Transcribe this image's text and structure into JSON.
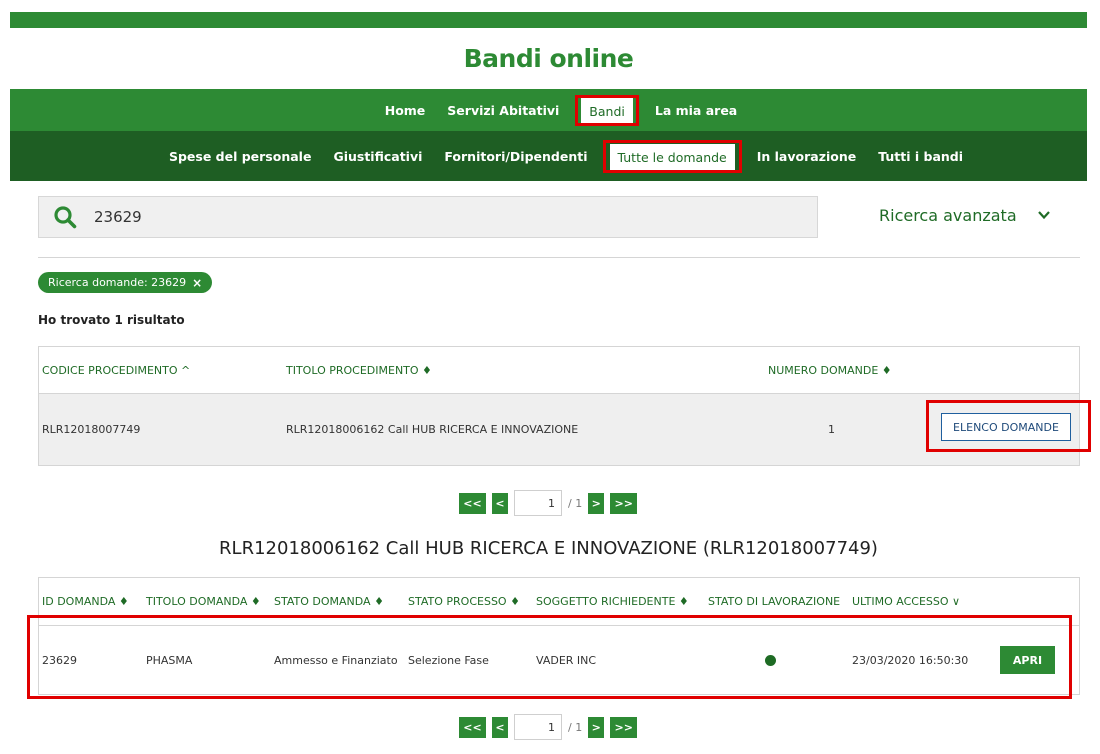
{
  "site": {
    "title": "Bandi online"
  },
  "nav_main": {
    "items": [
      {
        "label": "Home"
      },
      {
        "label": "Servizi Abitativi"
      },
      {
        "label": "Bandi"
      },
      {
        "label": "La mia area"
      }
    ],
    "active_index": 2
  },
  "nav_sub": {
    "items": [
      {
        "label": "Spese del personale"
      },
      {
        "label": "Giustificativi"
      },
      {
        "label": "Fornitori/Dipendenti"
      },
      {
        "label": "Tutte le domande"
      },
      {
        "label": "In lavorazione"
      },
      {
        "label": "Tutti i bandi"
      }
    ],
    "active_index": 3
  },
  "search": {
    "value": "23629",
    "icon": "search-icon",
    "advanced_label": "Ricerca avanzata",
    "advanced_icon": "chevron-down-icon"
  },
  "filter_chip": {
    "label": "Ricerca domande: 23629",
    "close_symbol": "×"
  },
  "results": {
    "count_text": "Ho trovato 1 risultato"
  },
  "procedures_table": {
    "headers": [
      "CODICE PROCEDIMENTO ^",
      "TITOLO PROCEDIMENTO ♦",
      "NUMERO DOMANDE ♦"
    ],
    "rows": [
      {
        "codice": "RLR12018007749",
        "titolo": "RLR12018006162 Call HUB RICERCA E INNOVAZIONE",
        "numero": "1",
        "action_label": "ELENCO DOMANDE"
      }
    ]
  },
  "pager1": {
    "first": "<<",
    "prev": "<",
    "page": "1",
    "total": "/ 1",
    "next": ">",
    "last": ">>"
  },
  "applications_section": {
    "title": "RLR12018006162 Call HUB RICERCA E INNOVAZIONE (RLR12018007749)"
  },
  "applications_table": {
    "headers": [
      "ID DOMANDA ♦",
      "TITOLO DOMANDA ♦",
      "STATO DOMANDA ♦",
      "STATO PROCESSO ♦",
      "SOGGETTO RICHIEDENTE ♦",
      "STATO DI LAVORAZIONE",
      "ULTIMO ACCESSO ∨"
    ],
    "rows": [
      {
        "id": "23629",
        "titolo": "PHASMA",
        "stato_domanda": "Ammesso e Finanziato",
        "stato_processo": "Selezione Fase",
        "soggetto": "VADER INC",
        "stato_lavorazione_color": "#1e6b24",
        "ultimo_accesso": "23/03/2020 16:50:30",
        "action_label": "APRI"
      }
    ]
  },
  "pager2": {
    "first": "<<",
    "prev": "<",
    "page": "1",
    "total": "/ 1",
    "next": ">",
    "last": ">>"
  },
  "colors": {
    "brand_green": "#2d8a34",
    "dark_green": "#1e5e23",
    "highlight_red": "#e00000"
  }
}
